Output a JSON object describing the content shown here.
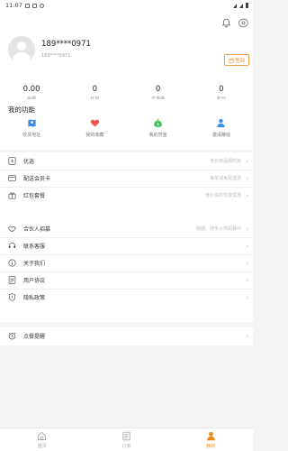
{
  "status_bar": {
    "time": "11:07"
  },
  "profile": {
    "username": "189****0971",
    "subtitle": "189****0971",
    "sign_in_label": "签到",
    "stats": [
      {
        "value": "0.00",
        "label": "余额"
      },
      {
        "value": "0",
        "label": "红包"
      },
      {
        "value": "0",
        "label": "优惠券"
      },
      {
        "value": "0",
        "label": "积分"
      }
    ]
  },
  "functions": {
    "title": "我的功能",
    "items": [
      {
        "label": "收货地址",
        "icon": "map-icon",
        "color": "#3d8fe8"
      },
      {
        "label": "我的收藏",
        "icon": "heart-icon",
        "color": "#f0564a"
      },
      {
        "label": "我的赏金",
        "icon": "money-bag-icon",
        "color": "#4bbf5e"
      },
      {
        "label": "邀请赚钱",
        "icon": "person-icon",
        "color": "#3d8fe8"
      }
    ]
  },
  "menu_groups": [
    {
      "items": [
        {
          "label": "优选",
          "hint": "低价商品限时抢",
          "icon": "flash-icon"
        },
        {
          "label": "配送会员卡",
          "hint": "每单减免配送费",
          "icon": "card-icon"
        },
        {
          "label": "红包套餐",
          "hint": "低价买红包享优惠",
          "icon": "gift-icon"
        }
      ]
    },
    {
      "items": [
        {
          "label": "合伙人招募",
          "hint": "跑腿、骑手火热招募中",
          "icon": "handshake-icon"
        },
        {
          "label": "联系客服",
          "hint": "",
          "icon": "headset-icon"
        },
        {
          "label": "关于我们",
          "hint": "",
          "icon": "info-icon"
        },
        {
          "label": "用户协议",
          "hint": "",
          "icon": "document-icon"
        },
        {
          "label": "隐私政策",
          "hint": "",
          "icon": "shield-icon"
        }
      ]
    },
    {
      "items": [
        {
          "label": "点餐提醒",
          "hint": "",
          "icon": "alarm-icon"
        }
      ]
    }
  ],
  "tab_bar": {
    "tabs": [
      {
        "label": "首页",
        "icon": "home-icon",
        "active": false
      },
      {
        "label": "订单",
        "icon": "order-icon",
        "active": false
      },
      {
        "label": "我的",
        "icon": "user-icon",
        "active": true
      }
    ]
  },
  "colors": {
    "accent": "#f08a1f",
    "background": "#f4f4f4"
  }
}
